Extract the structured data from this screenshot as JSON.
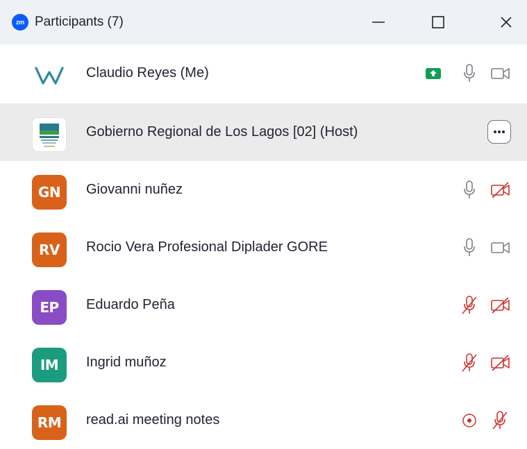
{
  "window": {
    "app_logo": "zm",
    "title": "Participants (7)"
  },
  "participants": [
    {
      "initials": "",
      "name": "Claudio Reyes (Me)",
      "avatar_color": "#ffffff",
      "audio": "on",
      "video": "off",
      "share": true
    },
    {
      "initials": "",
      "name": "Gobierno Regional de Los Lagos [02] (Host)",
      "avatar_color": "#ffffff",
      "selected": true,
      "more_label": "···"
    },
    {
      "initials": "GN",
      "name": "Giovanni nuñez",
      "avatar_color": "#d9621a",
      "audio": "on",
      "video": "muted"
    },
    {
      "initials": "RV",
      "name": "Rocio Vera Profesional Diplader GORE",
      "avatar_color": "#d9621a",
      "audio": "on",
      "video": "off"
    },
    {
      "initials": "EP",
      "name": "Eduardo Peña",
      "avatar_color": "#8a4cc4",
      "audio": "muted",
      "video": "muted"
    },
    {
      "initials": "IM",
      "name": "Ingrid muñoz",
      "avatar_color": "#1b9c7e",
      "audio": "muted",
      "video": "muted"
    },
    {
      "initials": "RM",
      "name": "read.ai meeting notes",
      "avatar_color": "#d9621a",
      "recording": true,
      "audio": "muted"
    }
  ],
  "colors": {
    "muted_red": "#d0312d",
    "icon_gray": "#7b7f86",
    "share_green": "#0f9d58"
  }
}
